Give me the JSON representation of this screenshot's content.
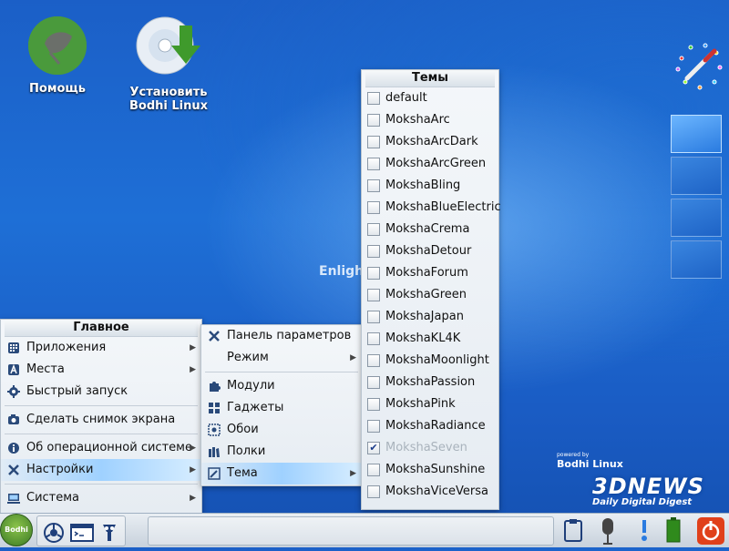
{
  "desktop": {
    "icons": [
      {
        "label_line1": "Помощь",
        "label_line2": ""
      },
      {
        "label_line1": "Установить",
        "label_line2": "Bodhi Linux"
      }
    ],
    "logo_text": "Enlight",
    "bodhi_small": "powered by",
    "bodhi_big": "Bodhi Linux",
    "news_big": "3DNEWS",
    "news_small": "Daily Digital Digest"
  },
  "menu_main": {
    "title": "Главное",
    "items": [
      {
        "label": "Приложения",
        "icon": "apps-grid-icon"
      },
      {
        "label": "Места",
        "icon": "places-icon"
      },
      {
        "label": "Быстрый запуск",
        "icon": "gear-icon"
      },
      {
        "label": "Сделать снимок экрана",
        "icon": "camera-icon"
      },
      {
        "label": "Об операционной системе",
        "icon": "info-icon"
      },
      {
        "label": "Настройки",
        "icon": "tools-icon"
      },
      {
        "label": "Система",
        "icon": "monitor-icon"
      }
    ]
  },
  "menu_settings": {
    "items": [
      {
        "label": "Панель параметров",
        "icon": "tools-icon"
      },
      {
        "label": "Режим",
        "icon": ""
      },
      {
        "label": "Модули",
        "icon": "puzzle-icon"
      },
      {
        "label": "Гаджеты",
        "icon": "gadgets-icon"
      },
      {
        "label": "Обои",
        "icon": "wallpaper-icon"
      },
      {
        "label": "Полки",
        "icon": "shelves-icon"
      },
      {
        "label": "Тема",
        "icon": "theme-icon"
      }
    ]
  },
  "menu_themes": {
    "title": "Темы",
    "items": [
      {
        "label": "default",
        "checked": false
      },
      {
        "label": "MokshaArc",
        "checked": false
      },
      {
        "label": "MokshaArcDark",
        "checked": false
      },
      {
        "label": "MokshaArcGreen",
        "checked": false
      },
      {
        "label": "MokshaBling",
        "checked": false
      },
      {
        "label": "MokshaBlueElectric",
        "checked": false
      },
      {
        "label": "MokshaCrema",
        "checked": false
      },
      {
        "label": "MokshaDetour",
        "checked": false
      },
      {
        "label": "MokshaForum",
        "checked": false
      },
      {
        "label": "MokshaGreen",
        "checked": false
      },
      {
        "label": "MokshaJapan",
        "checked": false
      },
      {
        "label": "MokshaKL4K",
        "checked": false
      },
      {
        "label": "MokshaMoonlight",
        "checked": false
      },
      {
        "label": "MokshaPassion",
        "checked": false
      },
      {
        "label": "MokshaPink",
        "checked": false
      },
      {
        "label": "MokshaRadiance",
        "checked": false
      },
      {
        "label": "MokshaSeven",
        "checked": true
      },
      {
        "label": "MokshaSunshine",
        "checked": false
      },
      {
        "label": "MokshaViceVersa",
        "checked": false
      }
    ]
  },
  "taskbar": {
    "start_label": "Bodhi",
    "launchers": [
      "browser-icon",
      "terminal-icon",
      "filemanager-icon"
    ],
    "tray": [
      "clipboard-icon",
      "microphone-icon",
      "alert-icon",
      "battery-icon",
      "power-icon"
    ]
  },
  "colors": {
    "accent_green": "#4a9a3c",
    "selection": "#9fd1ff",
    "power_red": "#e0401a"
  }
}
